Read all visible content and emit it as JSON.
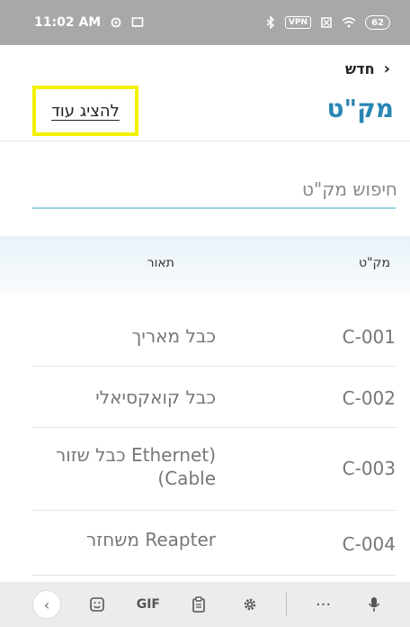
{
  "status_bar": {
    "time": "11:02 AM",
    "left_icons": [
      "gear-icon",
      "screenshot-icon"
    ],
    "right_icons": [
      "bluetooth-icon",
      "vpn-icon",
      "sim-off-icon",
      "wifi-icon"
    ],
    "vpn_label": "VPN",
    "battery_label": "62"
  },
  "header": {
    "back_label": "חדש",
    "title": "מק\"ט",
    "show_more_label": "להציג עוד",
    "highlight_color": "#f2f200",
    "accent_color": "#2a86b2"
  },
  "search": {
    "placeholder": "חיפוש מק\"ט",
    "value": ""
  },
  "table": {
    "headers": {
      "sku": "מק\"ט",
      "description": "תאור"
    },
    "rows": [
      {
        "sku": "C-001",
        "description": "כבל מאריך"
      },
      {
        "sku": "C-002",
        "description": "כבל קואקסיאלי"
      },
      {
        "sku": "C-003",
        "description": "(Ethernet כבל שזור Cable)"
      },
      {
        "sku": "C-004",
        "description": "Reapter משחזר"
      }
    ]
  },
  "keyboard_bar": {
    "items": [
      "back-icon",
      "sticker-icon",
      "GIF",
      "clipboard-icon",
      "settings-icon",
      "more-icon",
      "mic-icon"
    ],
    "gif_label": "GIF"
  }
}
